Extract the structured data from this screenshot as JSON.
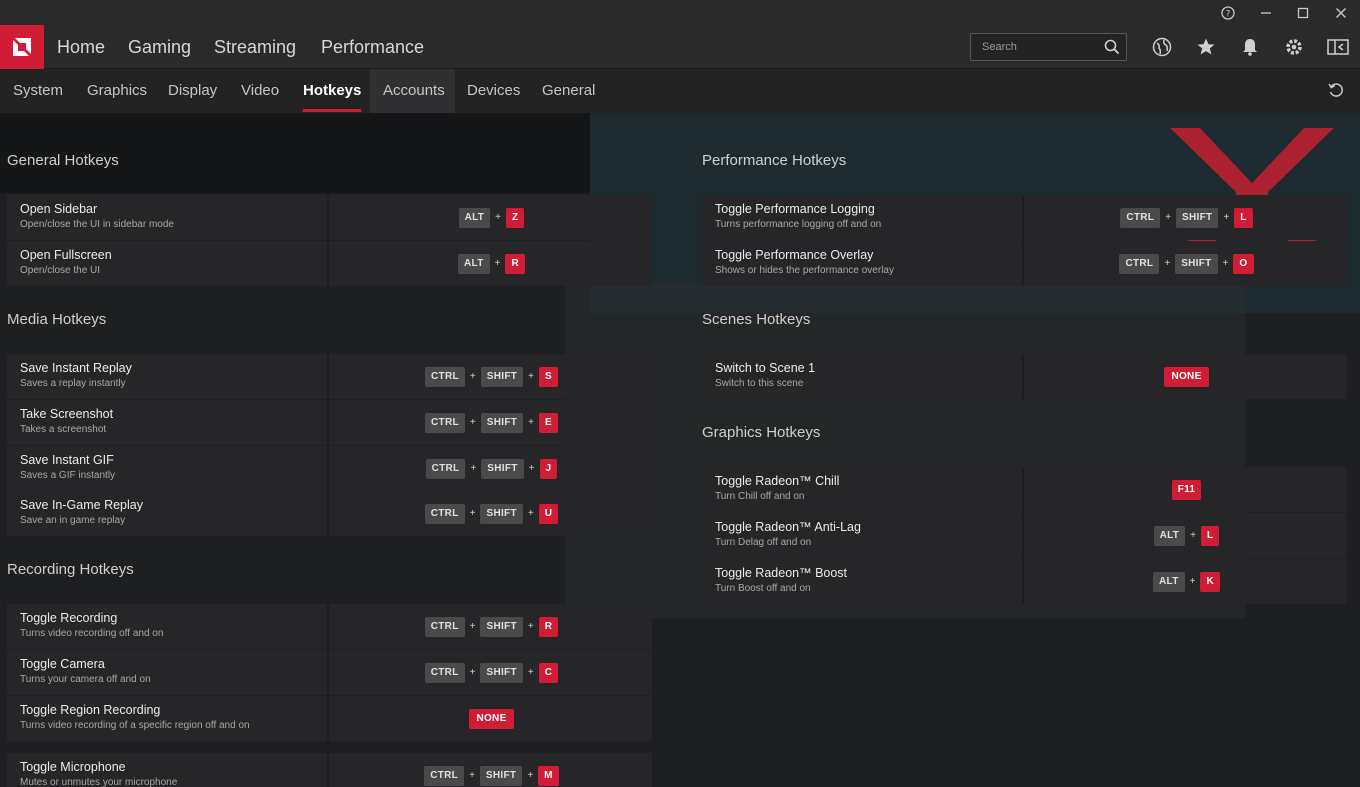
{
  "titlebar": {
    "help_icon": "help-circle-icon",
    "minimize_icon": "minimize-icon",
    "maximize_icon": "maximize-icon",
    "close_icon": "close-icon"
  },
  "mainnav": {
    "items": [
      "Home",
      "Gaming",
      "Streaming",
      "Performance"
    ],
    "search_placeholder": "Search"
  },
  "subnav": {
    "items": [
      "System",
      "Graphics",
      "Display",
      "Video",
      "Hotkeys",
      "Accounts",
      "Devices",
      "General"
    ],
    "active": "Hotkeys"
  },
  "colors": {
    "accent": "#d01c35",
    "background": "#1c1c1e",
    "row": "#262628",
    "key_mod": "#4a4a4c"
  },
  "left": {
    "general_title": "General Hotkeys",
    "general": [
      {
        "title": "Open Sidebar",
        "desc": "Open/close the UI in sidebar mode",
        "mods": [
          "ALT"
        ],
        "key": "Z"
      },
      {
        "title": "Open Fullscreen",
        "desc": "Open/close the UI",
        "mods": [
          "ALT"
        ],
        "key": "R"
      }
    ],
    "media_title": "Media Hotkeys",
    "media": [
      {
        "title": "Save Instant Replay",
        "desc": "Saves a replay instantly",
        "mods": [
          "CTRL",
          "SHIFT"
        ],
        "key": "S"
      },
      {
        "title": "Take Screenshot",
        "desc": "Takes a screenshot",
        "mods": [
          "CTRL",
          "SHIFT"
        ],
        "key": "E"
      },
      {
        "title": "Save Instant GIF",
        "desc": "Saves a GIF instantly",
        "mods": [
          "CTRL",
          "SHIFT"
        ],
        "key": "J"
      },
      {
        "title": "Save In-Game Replay",
        "desc": "Save an in game replay",
        "mods": [
          "CTRL",
          "SHIFT"
        ],
        "key": "U"
      }
    ],
    "recording_title": "Recording Hotkeys",
    "recording": [
      {
        "title": "Toggle Recording",
        "desc": "Turns video recording off and on",
        "mods": [
          "CTRL",
          "SHIFT"
        ],
        "key": "R"
      },
      {
        "title": "Toggle Camera",
        "desc": "Turns your camera off and on",
        "mods": [
          "CTRL",
          "SHIFT"
        ],
        "key": "C"
      },
      {
        "title": "Toggle Region Recording",
        "desc": "Turns video recording of a specific region off and on",
        "none": "NONE"
      },
      {
        "title": "Toggle Microphone",
        "desc": "Mutes or unmutes your microphone",
        "mods": [
          "CTRL",
          "SHIFT"
        ],
        "key": "M"
      }
    ]
  },
  "right": {
    "performance_title": "Performance Hotkeys",
    "performance": [
      {
        "title": "Toggle Performance Logging",
        "desc": "Turns performance logging off and on",
        "mods": [
          "CTRL",
          "SHIFT"
        ],
        "key": "L"
      },
      {
        "title": "Toggle Performance Overlay",
        "desc": "Shows or hides the performance overlay",
        "mods": [
          "CTRL",
          "SHIFT"
        ],
        "key": "O"
      }
    ],
    "scenes_title": "Scenes Hotkeys",
    "scenes": [
      {
        "title": "Switch to Scene 1",
        "desc": "Switch to this scene",
        "none": "NONE"
      }
    ],
    "graphics_title": "Graphics Hotkeys",
    "graphics": [
      {
        "title": "Toggle Radeon™ Chill",
        "desc": "Turn Chill off and on",
        "key": "F11"
      },
      {
        "title": "Toggle Radeon™ Anti-Lag",
        "desc": "Turn Delag off and on",
        "mods": [
          "ALT"
        ],
        "key": "L"
      },
      {
        "title": "Toggle Radeon™ Boost",
        "desc": "Turn Boost off and on",
        "mods": [
          "ALT"
        ],
        "key": "K"
      }
    ]
  }
}
